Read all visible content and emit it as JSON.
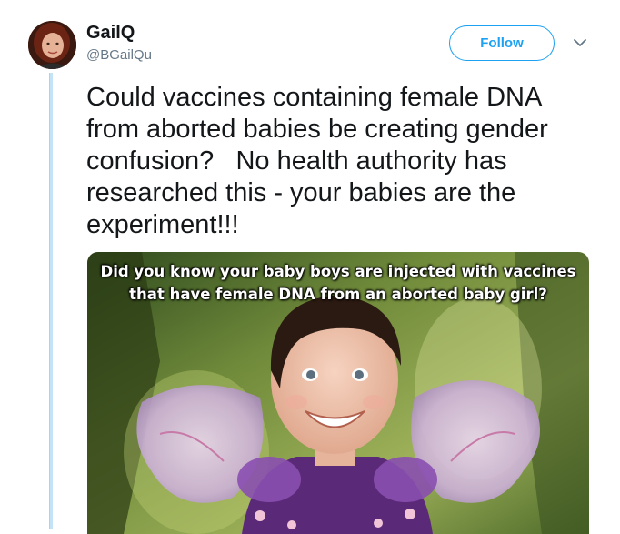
{
  "tweet": {
    "author": {
      "name": "GailQ",
      "handle": "@BGailQu",
      "avatar_icon": "profile-photo"
    },
    "follow_label": "Follow",
    "caret_icon": "chevron-down-icon",
    "text": "Could vaccines containing female DNA from aborted babies be creating gender confusion?   No health authority has researched this - your babies are the experiment!!!",
    "media": {
      "overlay_text": "Did you know your baby boys are injected with vaccines that have female DNA from an aborted baby girl?"
    }
  },
  "colors": {
    "accent": "#1da1f2",
    "text": "#14171a",
    "muted": "#657786",
    "thread_line": "#c5e3f6"
  }
}
